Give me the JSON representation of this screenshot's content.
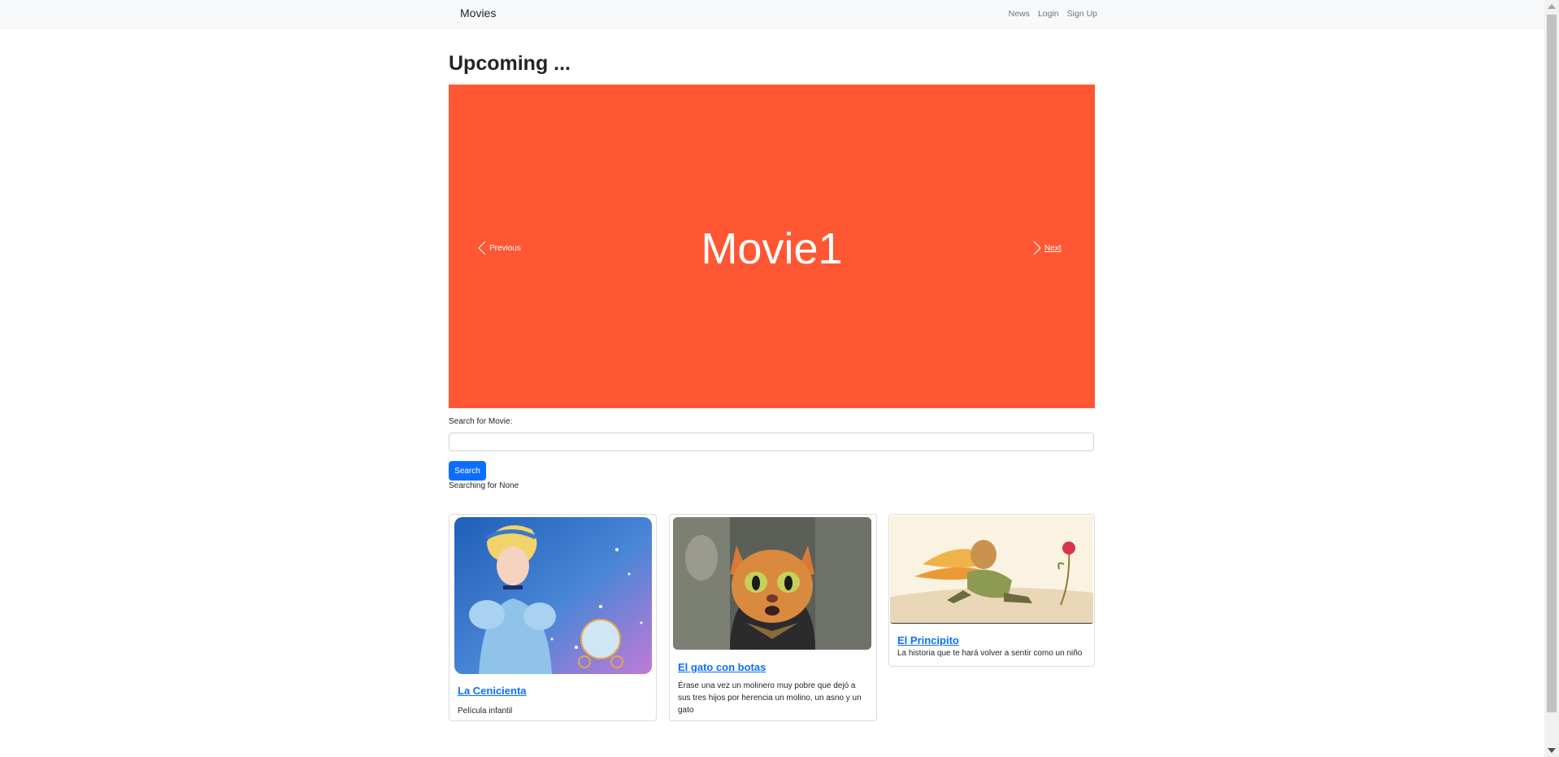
{
  "navbar": {
    "brand": "Movies",
    "links": [
      "News",
      "Login",
      "Sign Up"
    ]
  },
  "page": {
    "heading": "Upcoming ..."
  },
  "carousel": {
    "slide_text": "Movie1",
    "background": "#ff5733",
    "prev_label": "Previous",
    "next_label": "Next"
  },
  "search": {
    "label": "Search for Movie:",
    "value": "",
    "placeholder": "",
    "button_label": "Search",
    "status": "Searching for None"
  },
  "cards": [
    {
      "title": "La Cenicienta",
      "text": "Película infantil"
    },
    {
      "title": "El gato con botas",
      "text": "Érase una vez un molinero muy pobre que dejó a sus tres hijos por herencia un molino, un asno y un gato"
    },
    {
      "title": "El Principito",
      "text": "La historia que te hará volver a sentir como un niño"
    }
  ],
  "colors": {
    "accent": "#0d6efd",
    "navbar_bg": "#f8f9fa"
  }
}
